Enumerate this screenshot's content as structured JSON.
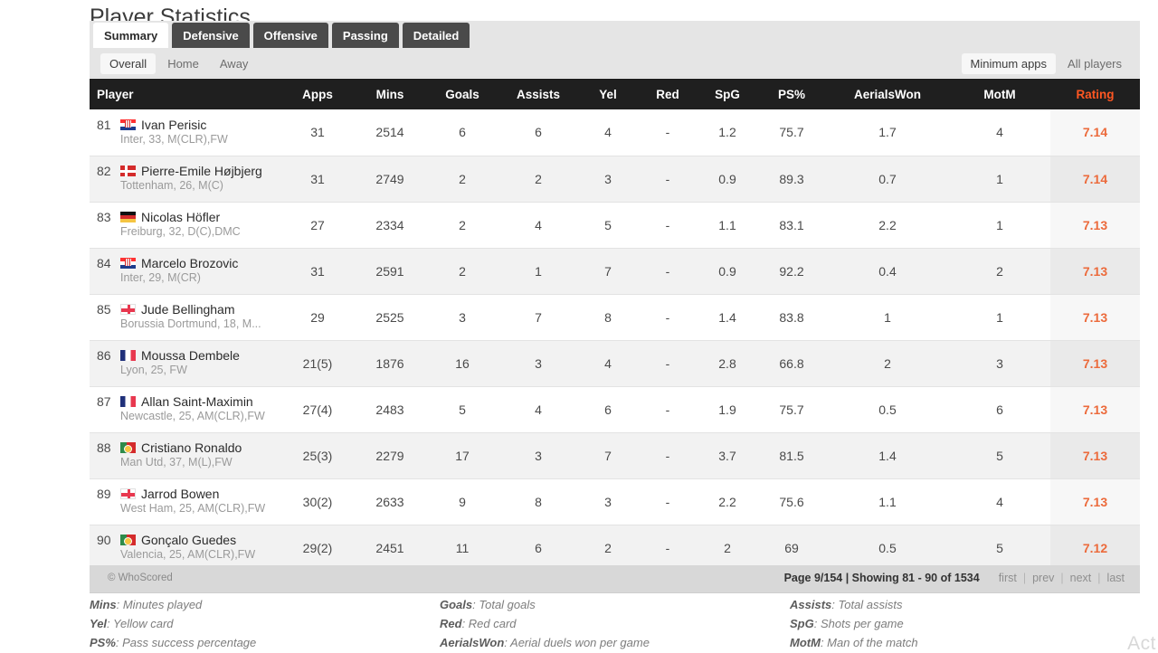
{
  "header": {
    "title": "Player Statistics"
  },
  "tabs": [
    {
      "label": "Summary",
      "active": true
    },
    {
      "label": "Defensive",
      "active": false
    },
    {
      "label": "Offensive",
      "active": false
    },
    {
      "label": "Passing",
      "active": false
    },
    {
      "label": "Detailed",
      "active": false
    }
  ],
  "filters": {
    "venue": [
      {
        "label": "Overall",
        "selected": true
      },
      {
        "label": "Home",
        "selected": false
      },
      {
        "label": "Away",
        "selected": false
      }
    ],
    "scope": [
      {
        "label": "Minimum apps",
        "selected": true
      },
      {
        "label": "All players",
        "selected": false
      }
    ]
  },
  "table": {
    "columns": [
      "Player",
      "Apps",
      "Mins",
      "Goals",
      "Assists",
      "Yel",
      "Red",
      "SpG",
      "PS%",
      "AerialsWon",
      "MotM",
      "Rating"
    ],
    "rows": [
      {
        "rank": "81",
        "flag": "hr",
        "name": "Ivan Perisic",
        "meta": "Inter,  33, M(CLR),FW",
        "apps": "31",
        "mins": "2514",
        "goals": "6",
        "assists": "6",
        "yel": "4",
        "red": "-",
        "spg": "1.2",
        "ps": "75.7",
        "aerials": "1.7",
        "motm": "4",
        "rating": "7.14"
      },
      {
        "rank": "82",
        "flag": "dk",
        "name": "Pierre-Emile Højbjerg",
        "meta": "Tottenham,  26, M(C)",
        "apps": "31",
        "mins": "2749",
        "goals": "2",
        "assists": "2",
        "yel": "3",
        "red": "-",
        "spg": "0.9",
        "ps": "89.3",
        "aerials": "0.7",
        "motm": "1",
        "rating": "7.14"
      },
      {
        "rank": "83",
        "flag": "de",
        "name": "Nicolas Höfler",
        "meta": "Freiburg,  32, D(C),DMC",
        "apps": "27",
        "mins": "2334",
        "goals": "2",
        "assists": "4",
        "yel": "5",
        "red": "-",
        "spg": "1.1",
        "ps": "83.1",
        "aerials": "2.2",
        "motm": "1",
        "rating": "7.13"
      },
      {
        "rank": "84",
        "flag": "hr",
        "name": "Marcelo Brozovic",
        "meta": "Inter,  29, M(CR)",
        "apps": "31",
        "mins": "2591",
        "goals": "2",
        "assists": "1",
        "yel": "7",
        "red": "-",
        "spg": "0.9",
        "ps": "92.2",
        "aerials": "0.4",
        "motm": "2",
        "rating": "7.13"
      },
      {
        "rank": "85",
        "flag": "en",
        "name": "Jude Bellingham",
        "meta": "Borussia Dortmund,  18, M...",
        "apps": "29",
        "mins": "2525",
        "goals": "3",
        "assists": "7",
        "yel": "8",
        "red": "-",
        "spg": "1.4",
        "ps": "83.8",
        "aerials": "1",
        "motm": "1",
        "rating": "7.13"
      },
      {
        "rank": "86",
        "flag": "fr",
        "name": "Moussa Dembele",
        "meta": "Lyon,  25, FW",
        "apps": "21(5)",
        "mins": "1876",
        "goals": "16",
        "assists": "3",
        "yel": "4",
        "red": "-",
        "spg": "2.8",
        "ps": "66.8",
        "aerials": "2",
        "motm": "3",
        "rating": "7.13"
      },
      {
        "rank": "87",
        "flag": "fr",
        "name": "Allan Saint-Maximin",
        "meta": "Newcastle,  25, AM(CLR),FW",
        "apps": "27(4)",
        "mins": "2483",
        "goals": "5",
        "assists": "4",
        "yel": "6",
        "red": "-",
        "spg": "1.9",
        "ps": "75.7",
        "aerials": "0.5",
        "motm": "6",
        "rating": "7.13"
      },
      {
        "rank": "88",
        "flag": "pt",
        "name": "Cristiano Ronaldo",
        "meta": "Man Utd,  37, M(L),FW",
        "apps": "25(3)",
        "mins": "2279",
        "goals": "17",
        "assists": "3",
        "yel": "7",
        "red": "-",
        "spg": "3.7",
        "ps": "81.5",
        "aerials": "1.4",
        "motm": "5",
        "rating": "7.13"
      },
      {
        "rank": "89",
        "flag": "en",
        "name": "Jarrod Bowen",
        "meta": "West Ham,  25, AM(CLR),FW",
        "apps": "30(2)",
        "mins": "2633",
        "goals": "9",
        "assists": "8",
        "yel": "3",
        "red": "-",
        "spg": "2.2",
        "ps": "75.6",
        "aerials": "1.1",
        "motm": "4",
        "rating": "7.13"
      },
      {
        "rank": "90",
        "flag": "pt",
        "name": "Gonçalo Guedes",
        "meta": "Valencia,  25, AM(CLR),FW",
        "apps": "29(2)",
        "mins": "2451",
        "goals": "11",
        "assists": "6",
        "yel": "2",
        "red": "-",
        "spg": "2",
        "ps": "69",
        "aerials": "0.5",
        "motm": "5",
        "rating": "7.12"
      }
    ]
  },
  "footer": {
    "copyright": "© WhoScored",
    "page_info": "Page 9/154 | Showing 81 - 90 of 1534",
    "links": [
      "first",
      "prev",
      "next",
      "last"
    ],
    "separator": "|"
  },
  "glossary": [
    [
      {
        "term": "Mins",
        "desc": ": Minutes played"
      },
      {
        "term": "Yel",
        "desc": ": Yellow card"
      },
      {
        "term": "PS%",
        "desc": ": Pass success percentage"
      }
    ],
    [
      {
        "term": "Goals",
        "desc": ": Total goals"
      },
      {
        "term": "Red",
        "desc": ": Red card"
      },
      {
        "term": "AerialsWon",
        "desc": ": Aerial duels won per game"
      }
    ],
    [
      {
        "term": "Assists",
        "desc": ": Total assists"
      },
      {
        "term": "SpG",
        "desc": ": Shots per game"
      },
      {
        "term": "MotM",
        "desc": ": Man of the match"
      }
    ]
  ],
  "watermark": {
    "text": "Act"
  },
  "colors": {
    "accent": "#ff5722",
    "rating": "#ec6a3b",
    "header_bg": "#1f1f1f",
    "tab_bg": "#4a4a4a"
  }
}
